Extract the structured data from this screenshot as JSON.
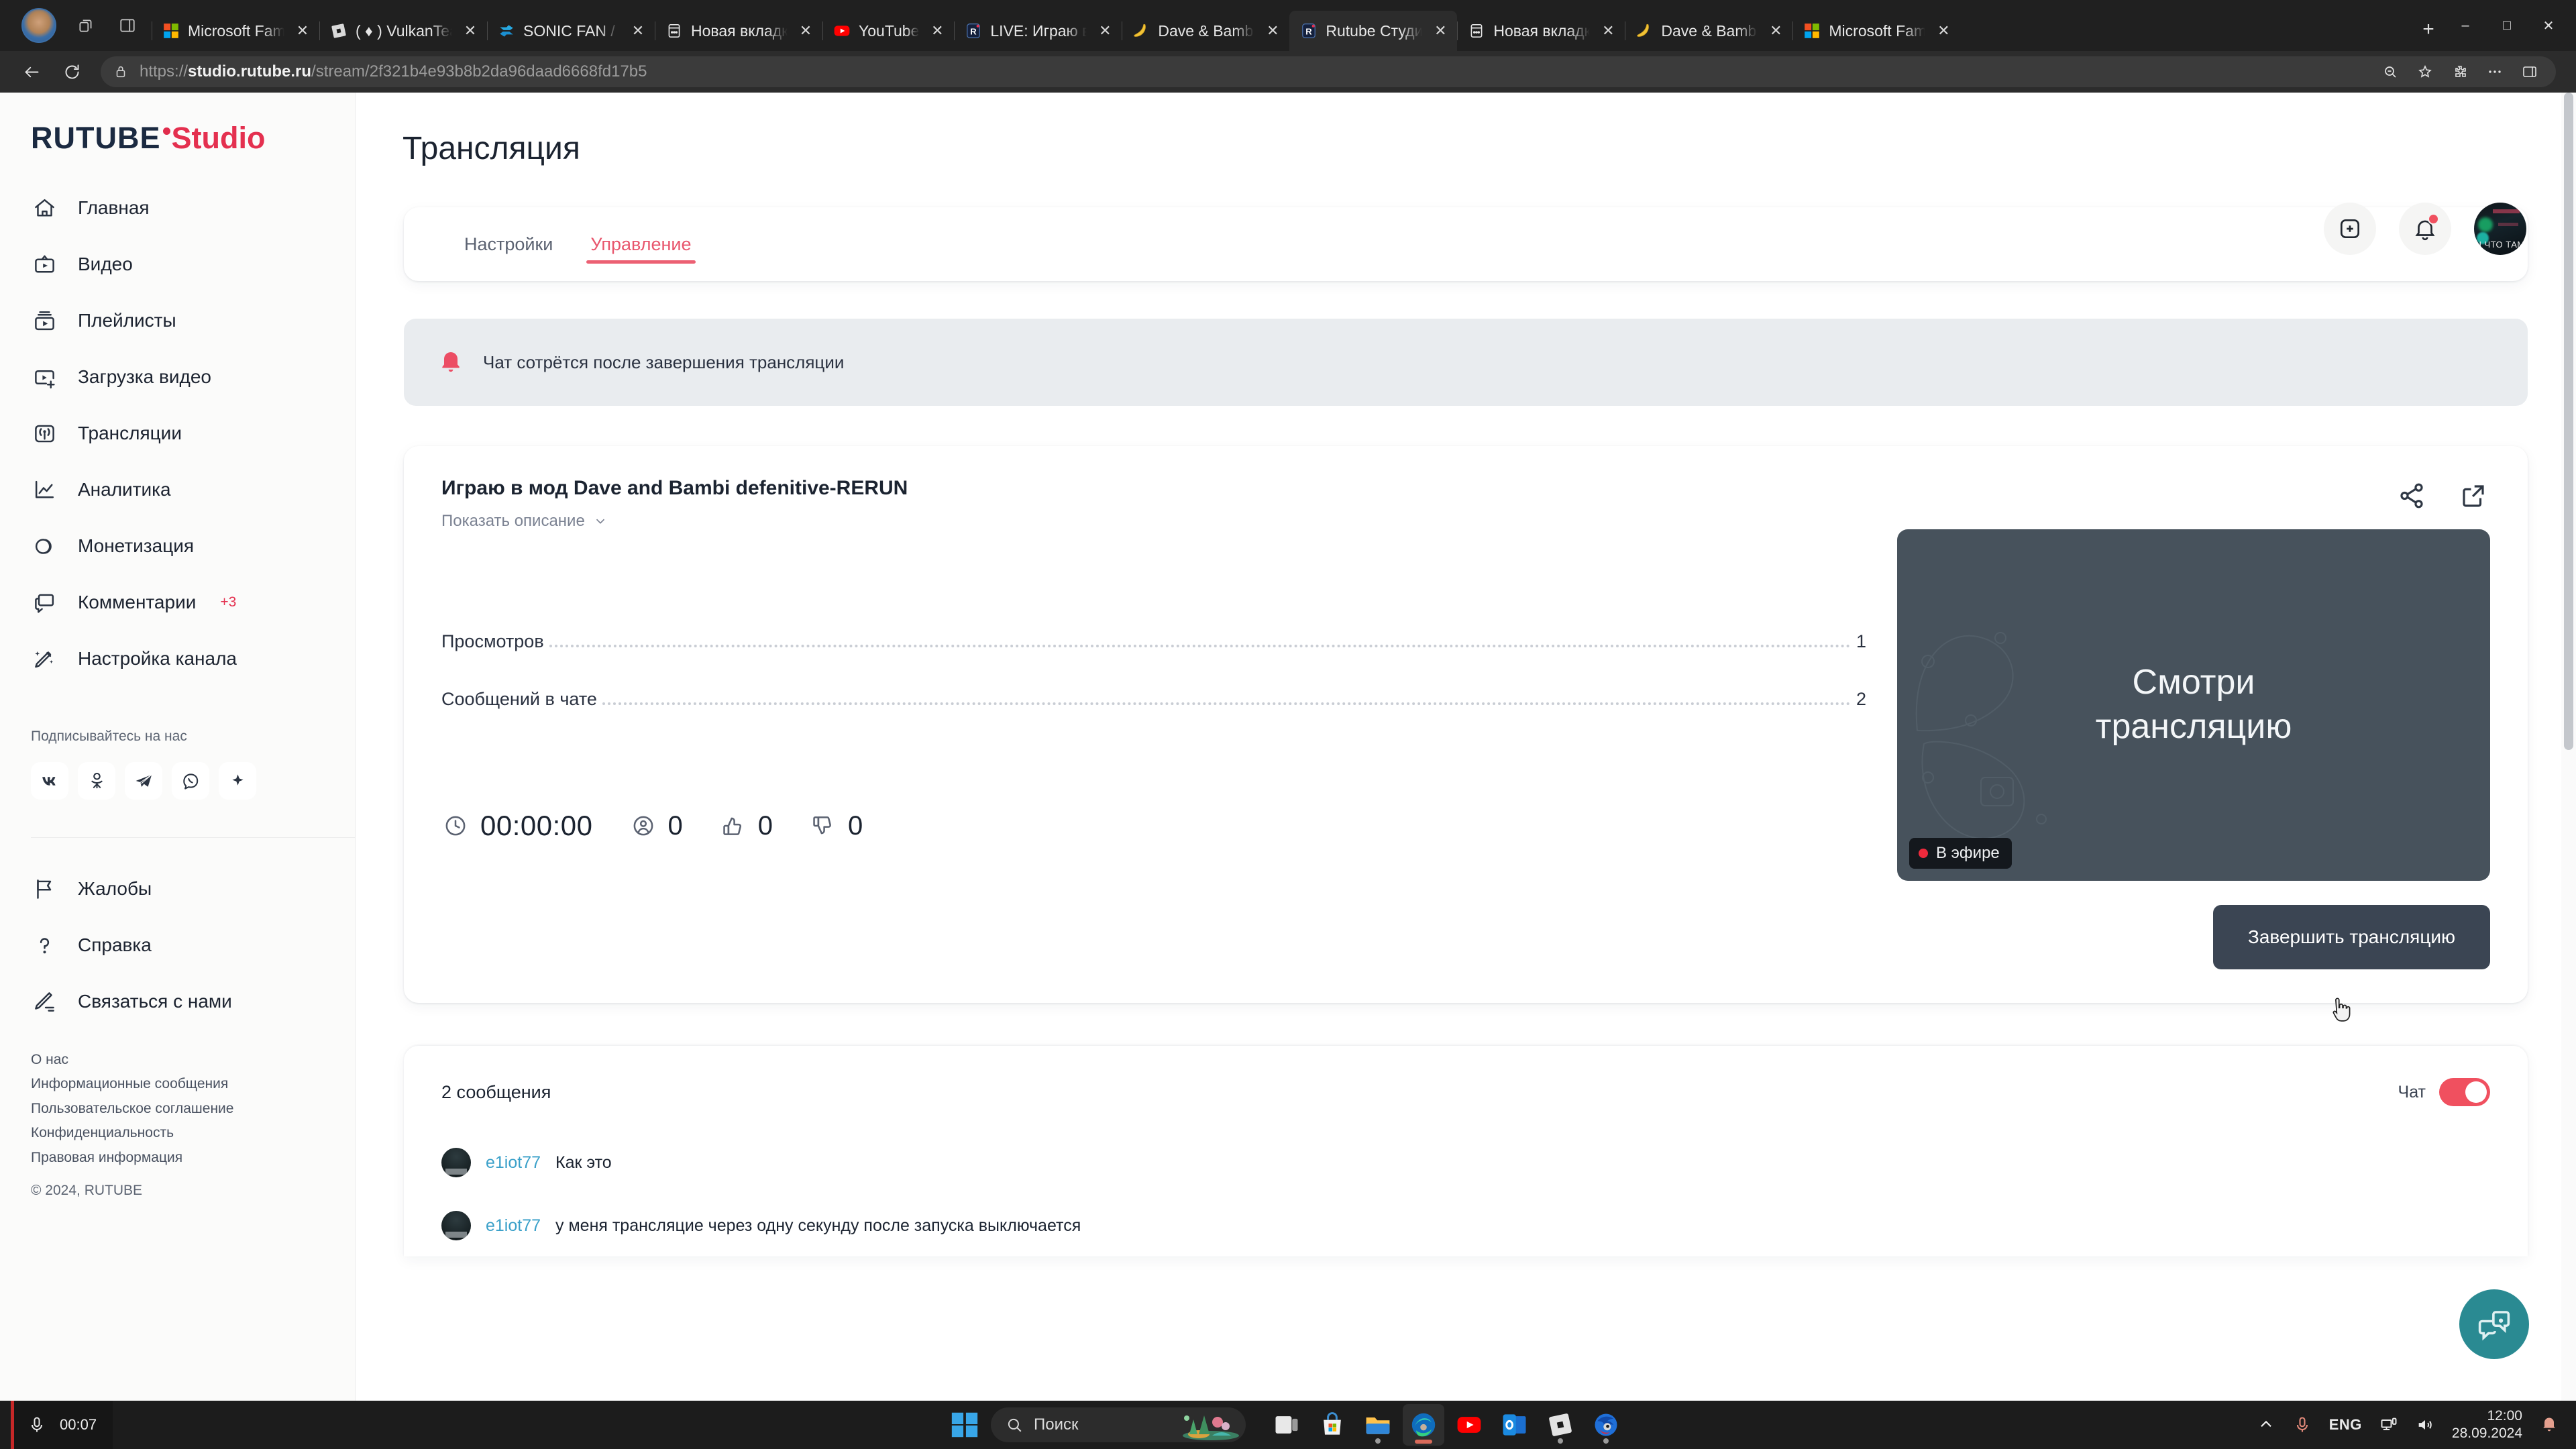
{
  "browser": {
    "tabs": [
      {
        "title": "Microsoft Fami",
        "favicon": "microsoft-icon",
        "active": false
      },
      {
        "title": "( ♦ ) VulkanTea",
        "favicon": "roblox-icon",
        "active": false
      },
      {
        "title": "SONIC FAN / С",
        "favicon": "shuffle-icon",
        "active": false
      },
      {
        "title": "Новая вкладка",
        "favicon": "newtab-icon",
        "active": false
      },
      {
        "title": "YouTube",
        "favicon": "youtube-icon",
        "active": false
      },
      {
        "title": "LIVE: Играю в м",
        "favicon": "rutube-icon",
        "active": false
      },
      {
        "title": "Dave & Bambi",
        "favicon": "banana-icon",
        "active": false
      },
      {
        "title": "Rutube Студия",
        "favicon": "rutube-icon",
        "active": true
      },
      {
        "title": "Новая вкладка",
        "favicon": "newtab-icon",
        "active": false
      },
      {
        "title": "Dave & Bambi",
        "favicon": "banana-icon",
        "active": false
      },
      {
        "title": "Microsoft Fami",
        "favicon": "microsoft-icon",
        "active": false
      }
    ],
    "new_tab_label": "+",
    "window_controls": {
      "minimize": "–",
      "maximize": "□",
      "close": "✕"
    },
    "url": {
      "scheme": "https://",
      "host": "studio.rutube.ru",
      "path": "/stream/2f321b4e93b8b2da96daad6668fd17b5"
    }
  },
  "sidebar": {
    "logo": {
      "primary": "RUTUBE",
      "secondary": "Studio"
    },
    "nav": [
      {
        "label": "Главная",
        "icon": "home-icon"
      },
      {
        "label": "Видео",
        "icon": "video-icon"
      },
      {
        "label": "Плейлисты",
        "icon": "playlist-icon"
      },
      {
        "label": "Загрузка видео",
        "icon": "upload-video-icon"
      },
      {
        "label": "Трансляции",
        "icon": "broadcast-icon"
      },
      {
        "label": "Аналитика",
        "icon": "analytics-icon"
      },
      {
        "label": "Монетизация",
        "icon": "monetization-icon"
      },
      {
        "label": "Комментарии",
        "icon": "comments-icon",
        "badge": "+3"
      },
      {
        "label": "Настройка канала",
        "icon": "channel-settings-icon"
      }
    ],
    "subscribe_title": "Подписывайтесь на нас",
    "socials": [
      "vk-icon",
      "ok-icon",
      "telegram-icon",
      "viber-icon",
      "plus-icon"
    ],
    "nav2": [
      {
        "label": "Жалобы",
        "icon": "flag-icon"
      },
      {
        "label": "Справка",
        "icon": "help-icon"
      },
      {
        "label": "Связаться с нами",
        "icon": "contact-icon"
      }
    ],
    "footer_links": [
      "О нас",
      "Информационные сообщения",
      "Пользовательское соглашение",
      "Конфиденциальность",
      "Правовая информация"
    ],
    "copyright": "© 2024, RUTUBE"
  },
  "header": {
    "add_icon": "add-square-icon",
    "bell_icon": "bell-icon",
    "avatar_text": "Ч ЧТО ТАМ",
    "has_notification": true
  },
  "main": {
    "page_title": "Трансляция",
    "tabs": [
      {
        "label": "Настройки",
        "active": false
      },
      {
        "label": "Управление",
        "active": true
      }
    ],
    "banner": {
      "icon": "bell-alert-icon",
      "text": "Чат сотрётся после завершения трансляции"
    },
    "stream": {
      "title": "Играю в мод Dave and Bambi defenitive-RERUN",
      "description_toggle": "Показать описание",
      "stats": [
        {
          "label": "Просмотров",
          "value": "1"
        },
        {
          "label": "Сообщений в чате",
          "value": "2"
        }
      ],
      "metrics": [
        {
          "icon": "clock-icon",
          "value": "00:00:00"
        },
        {
          "icon": "viewer-icon",
          "value": "0"
        },
        {
          "icon": "thumbs-up-icon",
          "value": "0"
        },
        {
          "icon": "thumbs-down-icon",
          "value": "0"
        }
      ],
      "actions": [
        "share-icon",
        "open-external-icon"
      ],
      "preview": {
        "overlay_line1": "Смотри",
        "overlay_line2": "трансляцию",
        "live_label": "В эфире"
      },
      "end_button": "Завершить трансляцию"
    },
    "chat": {
      "count_label": "2 сообщения",
      "toggle_label": "Чат",
      "toggle_on": true,
      "messages": [
        {
          "user": "e1iot77",
          "text": "Как это"
        },
        {
          "user": "e1iot77",
          "text": "у меня трансляцие через одну секунду после запуска выключается"
        }
      ]
    },
    "support_fab": "support-chat-icon"
  },
  "taskbar": {
    "recording": {
      "icon": "microphone-icon",
      "time": "00:07"
    },
    "start_icon": "windows-icon",
    "search": {
      "icon": "search-icon",
      "placeholder": "Поиск"
    },
    "apps": [
      {
        "name": "task-view-icon",
        "running": false
      },
      {
        "name": "microsoft-store-icon",
        "running": false
      },
      {
        "name": "file-explorer-icon",
        "running": true
      },
      {
        "name": "edge-icon",
        "running": true,
        "active": true
      },
      {
        "name": "youtube-icon",
        "running": false
      },
      {
        "name": "outlook-icon",
        "running": false
      },
      {
        "name": "roblox-icon",
        "running": true
      },
      {
        "name": "sonic-icon",
        "running": true
      }
    ],
    "tray": {
      "chevron": "chevron-up-icon",
      "mic": "microphone-muted-icon",
      "language": "ENG",
      "network": "network-icon",
      "volume": "volume-icon",
      "time": "12:00",
      "date": "28.09.2024",
      "notification": "bell-icon"
    }
  },
  "colors": {
    "accent": "#e4304f",
    "tab_active": "#ec6073",
    "toggle_on": "#f0505f",
    "fab": "#2a8a92",
    "preview_bg": "#47525c",
    "end_button": "#3b4553"
  }
}
